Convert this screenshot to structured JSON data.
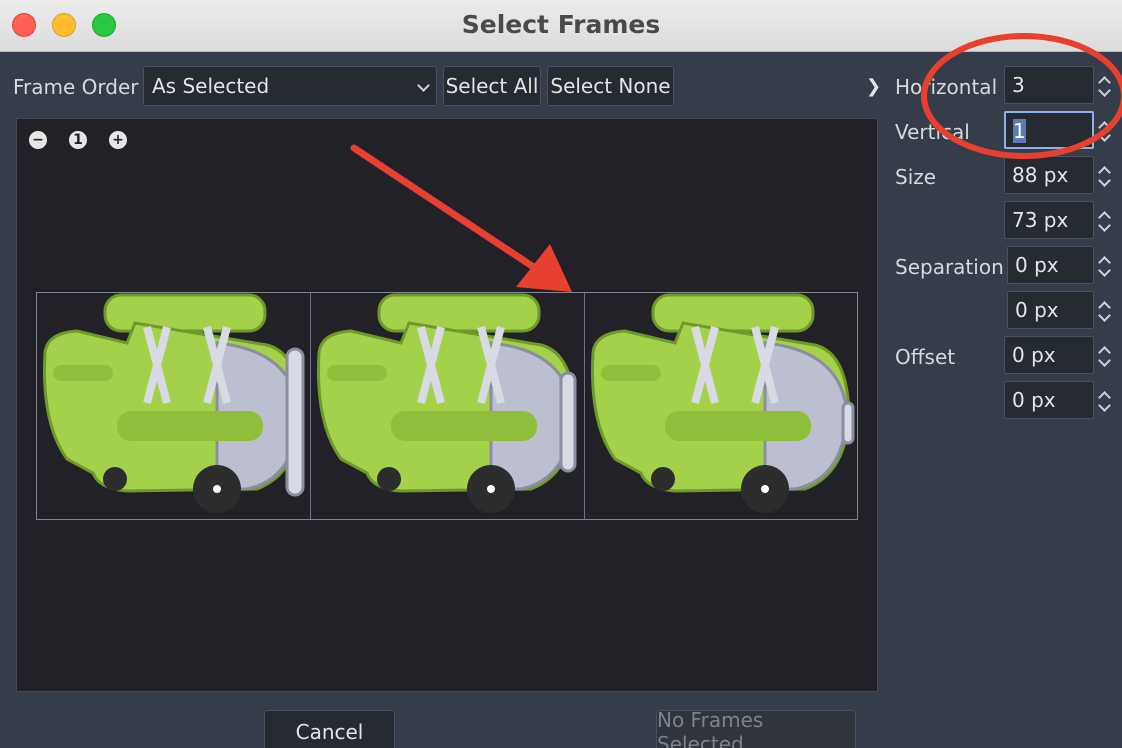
{
  "window": {
    "title": "Select Frames"
  },
  "toolbar": {
    "frame_order_label": "Frame Order",
    "frame_order_value": "As Selected",
    "select_all_label": "Select All",
    "select_none_label": "Select None"
  },
  "zoom": {
    "out_icon": "zoom-out-icon",
    "reset_label": "1",
    "in_icon": "zoom-in-icon"
  },
  "settings": {
    "horizontal_label": "Horizontal",
    "horizontal_value": "3",
    "vertical_label": "Vertical",
    "vertical_value": "1",
    "size_label": "Size",
    "size_x": "88 px",
    "size_y": "73 px",
    "separation_label": "Separation",
    "separation_x": "0 px",
    "separation_y": "0 px",
    "offset_label": "Offset",
    "offset_x": "0 px",
    "offset_y": "0 px"
  },
  "footer": {
    "cancel_label": "Cancel",
    "confirm_label": "No Frames Selected"
  },
  "colors": {
    "annotation": "#e8402f",
    "plane_body": "#a3d14a",
    "panel_bg": "#363d4a"
  }
}
